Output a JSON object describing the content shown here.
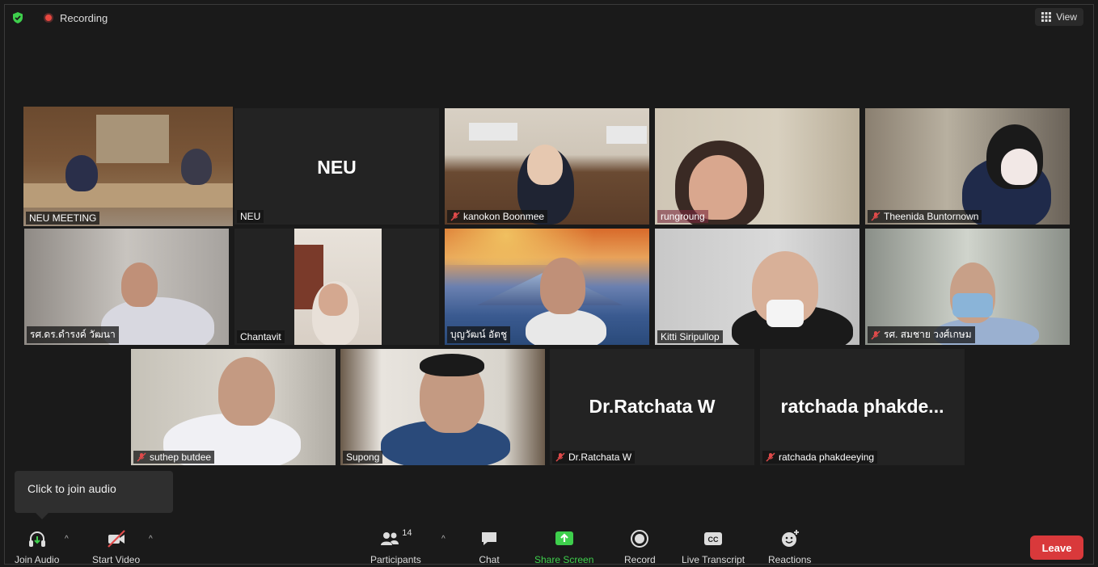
{
  "top": {
    "recording_label": "Recording",
    "view_label": "View"
  },
  "tiles": [
    {
      "name": "NEU MEETING"
    },
    {
      "name": "NEU",
      "big": "NEU"
    },
    {
      "name": "kanokon Boonmee"
    },
    {
      "name": "rungroung"
    },
    {
      "name": "Theenida Buntornown"
    },
    {
      "name": "รศ.ดร.ดำรงค์ วัฒนา"
    },
    {
      "name": "Chantavit"
    },
    {
      "name": "บุญวัฒน์ อัตชู"
    },
    {
      "name": "Kitti Siripullop"
    },
    {
      "name": "รศ. สมชาย วงศ์เกษม"
    },
    {
      "name": "suthep butdee"
    },
    {
      "name": "Supong"
    },
    {
      "name": "Dr.Ratchata W",
      "big": "Dr.Ratchata W"
    },
    {
      "name": "ratchada phakdeeying",
      "big": "ratchada  phakde..."
    }
  ],
  "tooltip": {
    "text": "Click to join audio"
  },
  "toolbar": {
    "join_audio": "Join Audio",
    "start_video": "Start Video",
    "participants": "Participants",
    "participants_count": "14",
    "chat": "Chat",
    "share_screen": "Share Screen",
    "record": "Record",
    "live_transcript": "Live Transcript",
    "reactions": "Reactions",
    "leave": "Leave"
  },
  "colors": {
    "active_speaker": "#c9e24d",
    "leave": "#d9393b",
    "share": "#3ecf4c"
  }
}
